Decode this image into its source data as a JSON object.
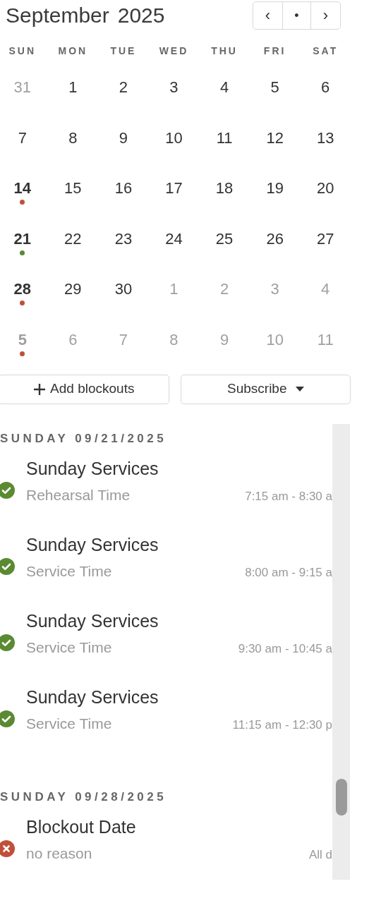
{
  "calendar": {
    "month": "September",
    "year": "2025",
    "nav": {
      "prev": "‹",
      "today": "•",
      "next": "›"
    },
    "weekdays": [
      "SUN",
      "MON",
      "TUE",
      "WED",
      "THU",
      "FRI",
      "SAT"
    ],
    "weeks": [
      [
        {
          "label": "31",
          "outside": true
        },
        {
          "label": "1",
          "outside": false
        },
        {
          "label": "2",
          "outside": false
        },
        {
          "label": "3",
          "outside": false
        },
        {
          "label": "4",
          "outside": false
        },
        {
          "label": "5",
          "outside": false
        },
        {
          "label": "6",
          "outside": false
        }
      ],
      [
        {
          "label": "7",
          "outside": false
        },
        {
          "label": "8",
          "outside": false
        },
        {
          "label": "9",
          "outside": false
        },
        {
          "label": "10",
          "outside": false
        },
        {
          "label": "11",
          "outside": false
        },
        {
          "label": "12",
          "outside": false
        },
        {
          "label": "13",
          "outside": false
        }
      ],
      [
        {
          "label": "14",
          "outside": false,
          "color": "#c0503a"
        },
        {
          "label": "15",
          "outside": false
        },
        {
          "label": "16",
          "outside": false
        },
        {
          "label": "17",
          "outside": false
        },
        {
          "label": "18",
          "outside": false
        },
        {
          "label": "19",
          "outside": false
        },
        {
          "label": "20",
          "outside": false
        }
      ],
      [
        {
          "label": "21",
          "outside": false,
          "color": "#5a8a32"
        },
        {
          "label": "22",
          "outside": false
        },
        {
          "label": "23",
          "outside": false
        },
        {
          "label": "24",
          "outside": false
        },
        {
          "label": "25",
          "outside": false
        },
        {
          "label": "26",
          "outside": false
        },
        {
          "label": "27",
          "outside": false
        }
      ],
      [
        {
          "label": "28",
          "outside": false,
          "color": "#c0503a"
        },
        {
          "label": "29",
          "outside": false
        },
        {
          "label": "30",
          "outside": false
        },
        {
          "label": "1",
          "outside": true
        },
        {
          "label": "2",
          "outside": true
        },
        {
          "label": "3",
          "outside": true
        },
        {
          "label": "4",
          "outside": true
        }
      ],
      [
        {
          "label": "5",
          "outside": true,
          "color": "#c0503a"
        },
        {
          "label": "6",
          "outside": true
        },
        {
          "label": "7",
          "outside": true
        },
        {
          "label": "8",
          "outside": true
        },
        {
          "label": "9",
          "outside": true
        },
        {
          "label": "10",
          "outside": true
        },
        {
          "label": "11",
          "outside": true
        }
      ]
    ]
  },
  "actions": {
    "add": "Add blockouts",
    "subscribe": "Subscribe"
  },
  "sections": [
    {
      "heading": "SUNDAY 09/21/2025",
      "events": [
        {
          "title": "Sunday Services",
          "subtitle": "Rehearsal Time",
          "time": "7:15 am - 8:30 a",
          "accepted": true
        },
        {
          "title": "Sunday Services",
          "subtitle": "Service Time",
          "time": "8:00 am - 9:15 a",
          "accepted": true
        },
        {
          "title": "Sunday Services",
          "subtitle": "Service Time",
          "time": "9:30 am - 10:45 a",
          "accepted": true
        },
        {
          "title": "Sunday Services",
          "subtitle": "Service Time",
          "time": "11:15 am - 12:30 p",
          "accepted": true
        }
      ]
    },
    {
      "heading": "SUNDAY 09/28/2025",
      "events": [
        {
          "title": "Blockout Date",
          "subtitle": "no reason",
          "time": "All d",
          "accepted": false
        }
      ]
    }
  ]
}
